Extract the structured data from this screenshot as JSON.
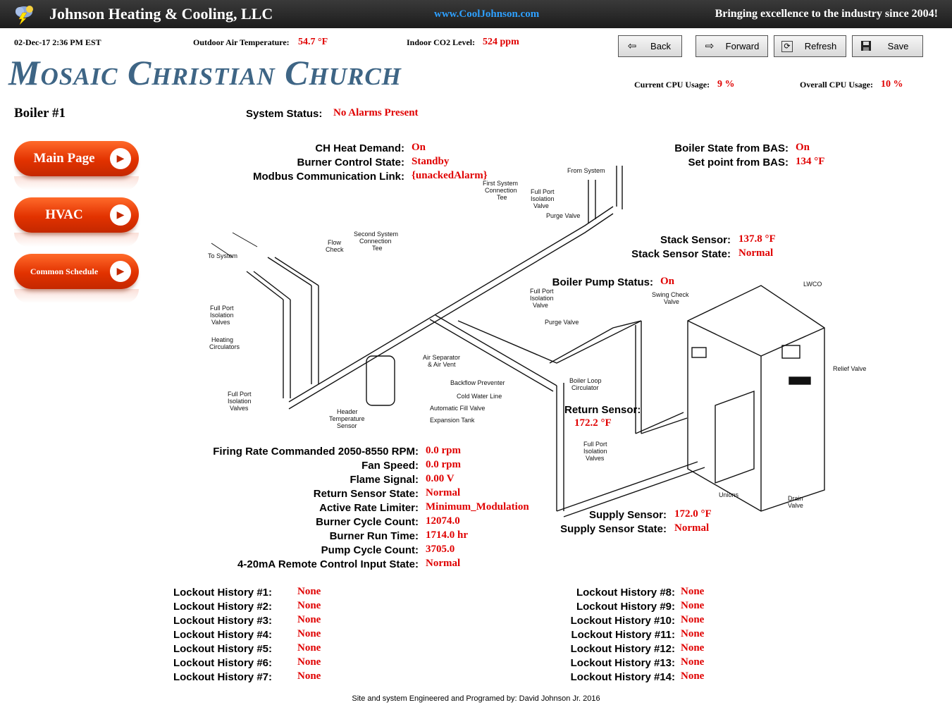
{
  "topbar": {
    "company": "Johnson Heating & Cooling, LLC",
    "website": "www.CoolJohnson.com",
    "tagline": "Bringing excellence to the industry since 2004!",
    "logo_icon": "lightning-cloud-icon"
  },
  "header": {
    "datetime": "02-Dec-17 2:36 PM EST",
    "outdoor_label": "Outdoor Air Temperature:",
    "outdoor_value": "54.7 °F",
    "co2_label": "Indoor CO2 Level:",
    "co2_value": "524 ppm",
    "title": "Mosaic Christian Church",
    "cpu_current_label": "Current CPU Usage:",
    "cpu_current_value": "9 %",
    "cpu_overall_label": "Overall CPU Usage:",
    "cpu_overall_value": "10 %"
  },
  "toolbar": {
    "back": "Back",
    "forward": "Forward",
    "refresh": "Refresh",
    "save": "Save"
  },
  "page": {
    "heading": "Boiler #1"
  },
  "nav": {
    "main": "Main Page",
    "hvac": "HVAC",
    "schedule": "Common Schedule"
  },
  "status": {
    "system_label": "System Status:",
    "system_value": "No Alarms Present",
    "ch_label": "CH Heat Demand:",
    "ch_value": "On",
    "burner_label": "Burner Control State:",
    "burner_value": "Standby",
    "modbus_label": "Modbus Communication Link:",
    "modbus_value": "{unackedAlarm}",
    "bas_state_label": "Boiler State from BAS:",
    "bas_state_value": "On",
    "setpoint_label": "Set point from BAS:",
    "setpoint_value": "134 °F",
    "stack_label": "Stack Sensor:",
    "stack_value": "137.8 °F",
    "stack_state_label": "Stack Sensor State:",
    "stack_state_value": "Normal",
    "pump_label": "Boiler Pump Status:",
    "pump_value": "On",
    "return_label": "Return Sensor:",
    "return_value": "172.2 °F",
    "supply_label": "Supply Sensor:",
    "supply_value": "172.0 °F",
    "supply_state_label": "Supply Sensor State:",
    "supply_state_value": "Normal"
  },
  "details": [
    {
      "label": "Firing Rate Commanded 2050-8550 RPM:",
      "value": "0.0 rpm"
    },
    {
      "label": "Fan Speed:",
      "value": "0.0 rpm"
    },
    {
      "label": "Flame Signal:",
      "value": "0.00 V"
    },
    {
      "label": "Return Sensor State:",
      "value": "Normal"
    },
    {
      "label": "Active Rate Limiter:",
      "value": "Minimum_Modulation"
    },
    {
      "label": "Burner Cycle Count:",
      "value": "12074.0"
    },
    {
      "label": "Burner Run Time:",
      "value": "1714.0 hr"
    },
    {
      "label": "Pump Cycle Count:",
      "value": "3705.0"
    },
    {
      "label": "4-20mA Remote Control Input State:",
      "value": "Normal"
    }
  ],
  "lockouts_left": [
    {
      "label": "Lockout History #1:",
      "value": "None"
    },
    {
      "label": "Lockout History #2:",
      "value": "None"
    },
    {
      "label": "Lockout History #3:",
      "value": "None"
    },
    {
      "label": "Lockout History #4:",
      "value": "None"
    },
    {
      "label": "Lockout History #5:",
      "value": "None"
    },
    {
      "label": "Lockout History #6:",
      "value": "None"
    },
    {
      "label": "Lockout History #7:",
      "value": "None"
    }
  ],
  "lockouts_right": [
    {
      "label": "Lockout History #8:",
      "value": "None"
    },
    {
      "label": "Lockout History #9:",
      "value": "None"
    },
    {
      "label": "Lockout History #10:",
      "value": "None"
    },
    {
      "label": "Lockout History #11:",
      "value": "None"
    },
    {
      "label": "Lockout History #12:",
      "value": "None"
    },
    {
      "label": "Lockout History #13:",
      "value": "None"
    },
    {
      "label": "Lockout History #14:",
      "value": "None"
    }
  ],
  "diagram_labels": {
    "to_system": "To System",
    "flow_check": "Flow Check",
    "second_tee": "Second System Connection Tee",
    "first_tee": "First System Connection Tee",
    "full_port_top": "Full Port Isolation Valve",
    "from_system": "From System",
    "purge_valve_top": "Purge Valve",
    "full_port_left": "Full Port Isolation Valves",
    "heating_circ": "Heating Circulators",
    "full_port_left_bottom": "Full Port Isolation Valves",
    "header_temp": "Header Temperature Sensor",
    "air_sep": "Air Separator & Air Vent",
    "backflow": "Backflow Preventer",
    "cold_water": "Cold Water Line",
    "auto_fill": "Automatic Fill Valve",
    "exp_tank": "Expansion Tank",
    "full_port_mid": "Full Port Isolation Valve",
    "purge_valve_mid": "Purge Valve",
    "boiler_loop": "Boiler Loop Circulator",
    "swing_check": "Swing Check Valve",
    "lwco": "LWCO",
    "relief": "Relief Valve",
    "full_port_boiler": "Full Port Isolation Valves",
    "unions": "Unions",
    "drain": "Drain Valve"
  },
  "footer": "Site and system Engineered and Programed by: David Johnson Jr. 2016"
}
